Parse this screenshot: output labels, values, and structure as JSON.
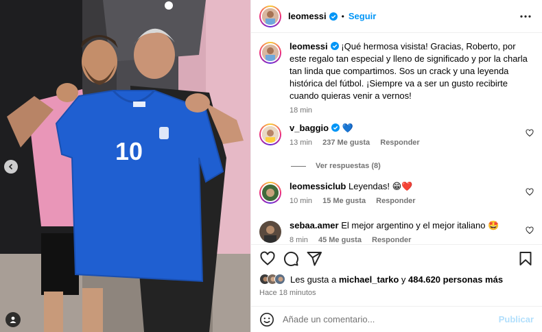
{
  "post": {
    "author": "leomessi",
    "follow_label": "Seguir",
    "separator": "•"
  },
  "caption": {
    "username": "leomessi",
    "text": "¡Qué hermosa visista! Gracias, Roberto, por este regalo tan especial y lleno de significado y por la charla tan linda que compartimos. Sos un crack y una leyenda histórica del fútbol. ¡Siempre va a ser un gusto recibirte cuando quieras venir a vernos!",
    "time": "18 min"
  },
  "comments": [
    {
      "username": "v_baggio",
      "text": "💙",
      "time": "13 min",
      "likes": "237 Me gusta",
      "reply": "Responder"
    },
    {
      "username": "leomessiclub",
      "text": "Leyendas! 😁❤️",
      "time": "10 min",
      "likes": "15 Me gusta",
      "reply": "Responder"
    },
    {
      "username": "sebaa.amer",
      "text": "El mejor argentino y el mejor italiano 🤩",
      "time": "8 min",
      "likes": "45 Me gusta",
      "reply": "Responder"
    }
  ],
  "replies_link": "Ver respuestas (8)",
  "likes": {
    "prefix": "Les gusta a",
    "user": "michael_tarko",
    "connector": "y",
    "others": "484.620 personas más"
  },
  "posted_ago": "Hace 18 minutos",
  "composer": {
    "placeholder": "Añade un comentario...",
    "post_label": "Publicar"
  },
  "photo": {
    "jersey_number": "10"
  },
  "colors": {
    "accent": "#0095f6",
    "verified": "#0095f6",
    "jersey": "#1f5fd1",
    "text_secondary": "#737373"
  },
  "icons": {
    "prev": "chevron-left-icon",
    "tagged": "person-icon",
    "more": "more-horizontal-icon",
    "like": "heart-outline-icon",
    "comment": "comment-icon",
    "share": "paper-plane-icon",
    "save": "bookmark-icon",
    "emoji": "smiley-icon"
  }
}
